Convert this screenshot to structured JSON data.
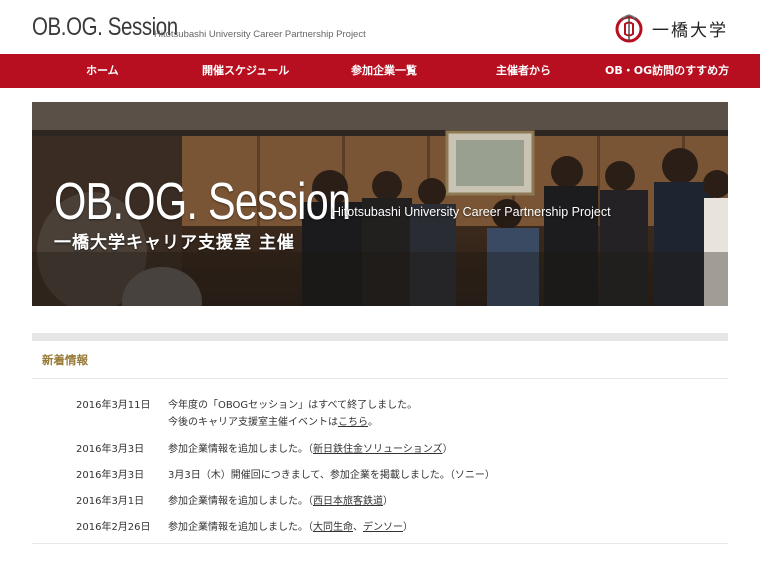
{
  "header": {
    "logo_main": "OB.OG. Session",
    "logo_sub": "Hitotsubashi University Career Partnership Project",
    "university_name": "一橋大学"
  },
  "nav": {
    "items": [
      "ホーム",
      "開催スケジュール",
      "参加企業一覧",
      "主催者から",
      "OB・OG訪問のすすめ方"
    ]
  },
  "hero": {
    "title": "OB.OG. Session",
    "subtitle": "Hitotsubashi University Career Partnership Project",
    "organizer": "一橋大学キャリア支援室 主催"
  },
  "news": {
    "heading": "新着情報",
    "items": [
      {
        "date": "2016年3月11日",
        "text": "今年度の「OBOGセッション」はすべて終了しました。",
        "line2_prefix": "今後のキャリア支援室主催イベントは",
        "line2_link": "こちら",
        "line2_suffix": "。"
      },
      {
        "date": "2016年3月3日",
        "prefix": "参加企業情報を追加しました。（",
        "link1": "新日鉄住金ソリューションズ",
        "sep": "",
        "link2": "",
        "suffix": "）"
      },
      {
        "date": "2016年3月3日",
        "text": "3月3日（木）開催回につきまして、参加企業を掲載しました。（ソニー）"
      },
      {
        "date": "2016年3月1日",
        "prefix": "参加企業情報を追加しました。（",
        "link1": "西日本旅客鉄道",
        "sep": "",
        "link2": "",
        "suffix": "）"
      },
      {
        "date": "2016年2月26日",
        "prefix": "参加企業情報を追加しました。（",
        "link1": "大同生命",
        "sep": "、",
        "link2": "デンソー",
        "suffix": "）"
      }
    ]
  },
  "colors": {
    "nav_bg": "#b70f1f",
    "heading": "#9a7c3a",
    "emblem_red": "#b70f1f"
  }
}
